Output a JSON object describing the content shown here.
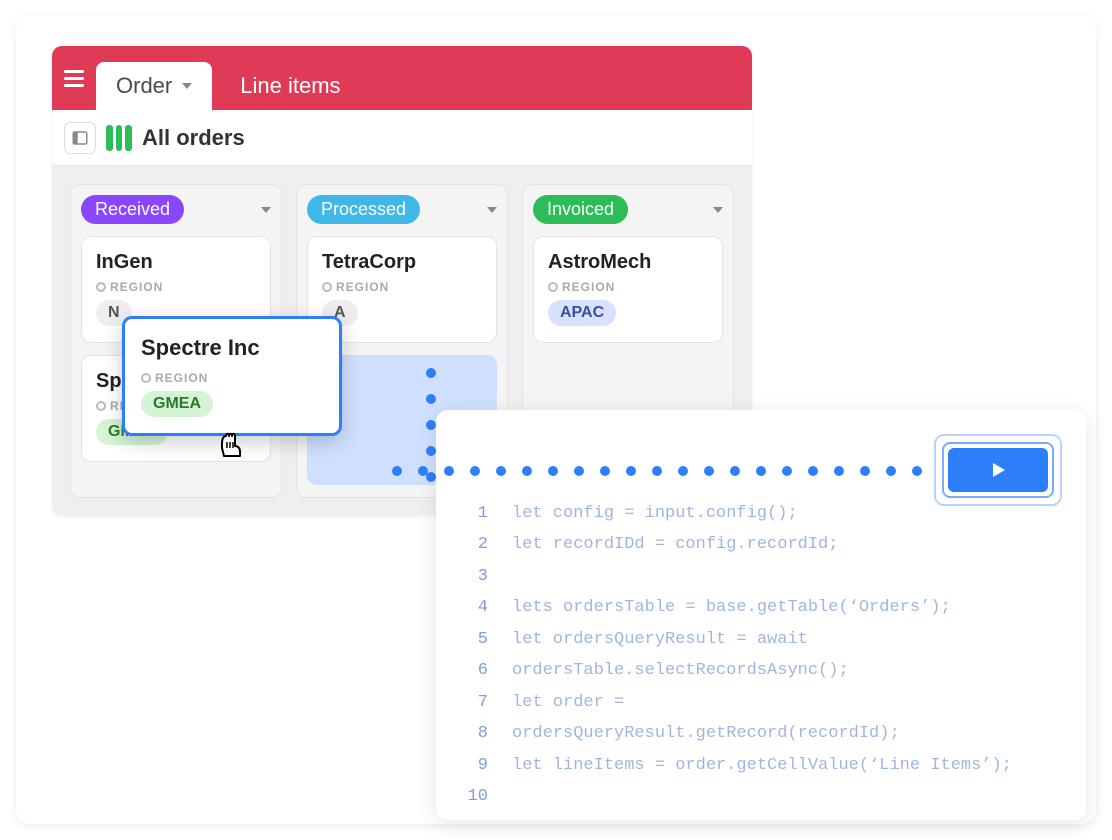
{
  "tabs": {
    "order": "Order",
    "lineItems": "Line items"
  },
  "viewbar": {
    "title": "All orders"
  },
  "columns": {
    "received": {
      "label": "Received"
    },
    "processed": {
      "label": "Processed"
    },
    "invoiced": {
      "label": "Invoiced"
    }
  },
  "fieldLabel": "REGION",
  "cards": {
    "ingen": {
      "title": "InGen",
      "region": "N"
    },
    "spectre_bg": {
      "title": "Sp",
      "region": "GMEA"
    },
    "tetra": {
      "title": "TetraCorp",
      "region": "A"
    },
    "astro": {
      "title": "AstroMech",
      "region": "APAC"
    }
  },
  "dragged": {
    "title": "Spectre Inc",
    "region": "GMEA"
  },
  "code": {
    "lines": [
      "let config = input.config();",
      "let recordIDd = config.recordId;",
      "",
      "lets ordersTable = base.getTable(‘Orders’);",
      "let ordersQueryResult = await",
      "ordersTable.selectRecordsAsync();",
      "let order =",
      "ordersQueryResult.getRecord(recordId);",
      "let lineItems = order.getCellValue(‘Line Items’);",
      ""
    ]
  }
}
